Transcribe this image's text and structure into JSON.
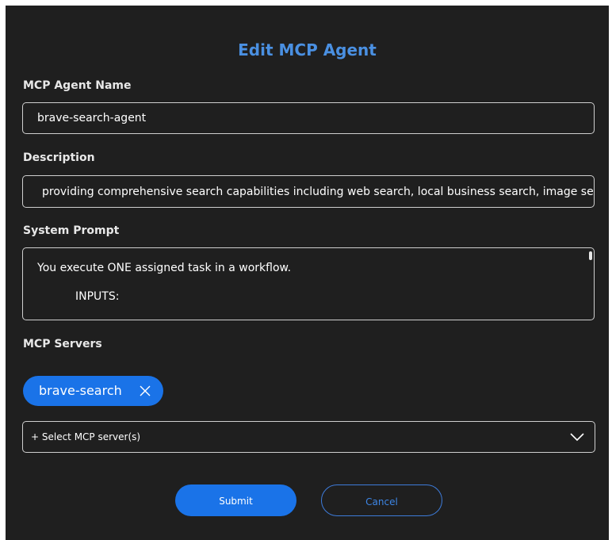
{
  "dialog": {
    "title": "Edit MCP Agent",
    "accent_color": "#4a90e2",
    "background_color": "#1f1f1f"
  },
  "agent_name": {
    "label": "MCP Agent Name",
    "value": "brave-search-agent"
  },
  "description": {
    "label": "Description",
    "value": " providing comprehensive search capabilities including web search, local business search, image search, news search"
  },
  "system_prompt": {
    "label": "System Prompt",
    "line1": "You execute ONE assigned task in a workflow.",
    "line2": "INPUTS:"
  },
  "mcp_servers": {
    "label": "MCP Servers",
    "selected": [
      {
        "label": "brave-search",
        "remove_icon": "close-icon"
      }
    ],
    "select_placeholder": "+ Select MCP server(s)",
    "dropdown_icon": "chevron-down-icon"
  },
  "actions": {
    "submit_label": "Submit",
    "cancel_label": "Cancel",
    "primary_color": "#1a73e8"
  }
}
